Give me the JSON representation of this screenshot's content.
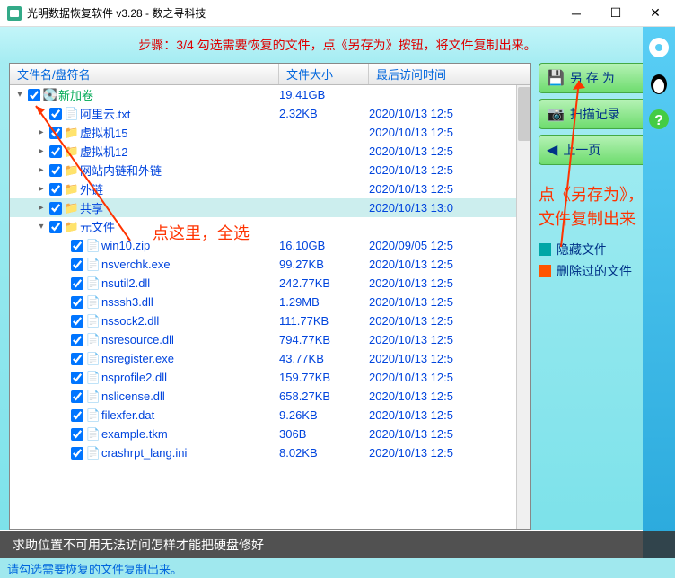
{
  "window": {
    "title": "光明数据恢复软件 v3.28 - 数之寻科技"
  },
  "step_text": "步骤：3/4 勾选需要恢复的文件，点《另存为》按钮，将文件复制出来。",
  "columns": {
    "name": "文件名/盘符名",
    "size": "文件大小",
    "time": "最后访问时间"
  },
  "rows": [
    {
      "indent": 0,
      "caret": "▾",
      "name": "新加卷",
      "size": "19.41GB",
      "time": "",
      "root": true,
      "icon": "💽"
    },
    {
      "indent": 1,
      "caret": "",
      "name": "阿里云.txt",
      "size": "2.32KB",
      "time": "2020/10/13 12:5",
      "icon": "📄"
    },
    {
      "indent": 1,
      "caret": "▸",
      "name": "虚拟机15",
      "size": "",
      "time": "2020/10/13 12:5",
      "icon": "📁",
      "folder": true
    },
    {
      "indent": 1,
      "caret": "▸",
      "name": "虚拟机12",
      "size": "",
      "time": "2020/10/13 12:5",
      "icon": "📁",
      "folder": true
    },
    {
      "indent": 1,
      "caret": "▸",
      "name": "网站内链和外链",
      "size": "",
      "time": "2020/10/13 12:5",
      "icon": "📁",
      "folder": true
    },
    {
      "indent": 1,
      "caret": "▸",
      "name": "外链",
      "size": "",
      "time": "2020/10/13 12:5",
      "icon": "📁",
      "folder": true
    },
    {
      "indent": 1,
      "caret": "▸",
      "name": "共享",
      "size": "",
      "time": "2020/10/13 13:0",
      "icon": "📁",
      "folder": true,
      "selected": true
    },
    {
      "indent": 1,
      "caret": "▾",
      "name": "元文件",
      "size": "",
      "time": "",
      "icon": "📁",
      "folder": true
    },
    {
      "indent": 2,
      "caret": "",
      "name": "win10.zip",
      "size": "16.10GB",
      "time": "2020/09/05 12:5",
      "icon": "📄"
    },
    {
      "indent": 2,
      "caret": "",
      "name": "nsverchk.exe",
      "size": "99.27KB",
      "time": "2020/10/13 12:5",
      "icon": "📄"
    },
    {
      "indent": 2,
      "caret": "",
      "name": "nsutil2.dll",
      "size": "242.77KB",
      "time": "2020/10/13 12:5",
      "icon": "📄"
    },
    {
      "indent": 2,
      "caret": "",
      "name": "nsssh3.dll",
      "size": "1.29MB",
      "time": "2020/10/13 12:5",
      "icon": "📄"
    },
    {
      "indent": 2,
      "caret": "",
      "name": "nssock2.dll",
      "size": "111.77KB",
      "time": "2020/10/13 12:5",
      "icon": "📄"
    },
    {
      "indent": 2,
      "caret": "",
      "name": "nsresource.dll",
      "size": "794.77KB",
      "time": "2020/10/13 12:5",
      "icon": "📄"
    },
    {
      "indent": 2,
      "caret": "",
      "name": "nsregister.exe",
      "size": "43.77KB",
      "time": "2020/10/13 12:5",
      "icon": "📄"
    },
    {
      "indent": 2,
      "caret": "",
      "name": "nsprofile2.dll",
      "size": "159.77KB",
      "time": "2020/10/13 12:5",
      "icon": "📄"
    },
    {
      "indent": 2,
      "caret": "",
      "name": "nslicense.dll",
      "size": "658.27KB",
      "time": "2020/10/13 12:5",
      "icon": "📄"
    },
    {
      "indent": 2,
      "caret": "",
      "name": "filexfer.dat",
      "size": "9.26KB",
      "time": "2020/10/13 12:5",
      "icon": "📄"
    },
    {
      "indent": 2,
      "caret": "",
      "name": "example.tkm",
      "size": "306B",
      "time": "2020/10/13 12:5",
      "icon": "📄"
    },
    {
      "indent": 2,
      "caret": "",
      "name": "crashrpt_lang.ini",
      "size": "8.02KB",
      "time": "2020/10/13 12:5",
      "icon": "📄"
    }
  ],
  "side_buttons": {
    "save_as": "另 存 为",
    "scan_log": "扫描记录",
    "prev_page": "上一页"
  },
  "legend": {
    "hidden": "隐藏文件",
    "deleted": "删除过的文件"
  },
  "anno_select_all": "点这里，全选",
  "anno_saveas": "点《另存为》，将文件复制出来",
  "bottom_text": "求助位置不可用无法访问怎样才能把硬盘修好",
  "status_text": "请勾选需要恢复的文件复制出来。"
}
